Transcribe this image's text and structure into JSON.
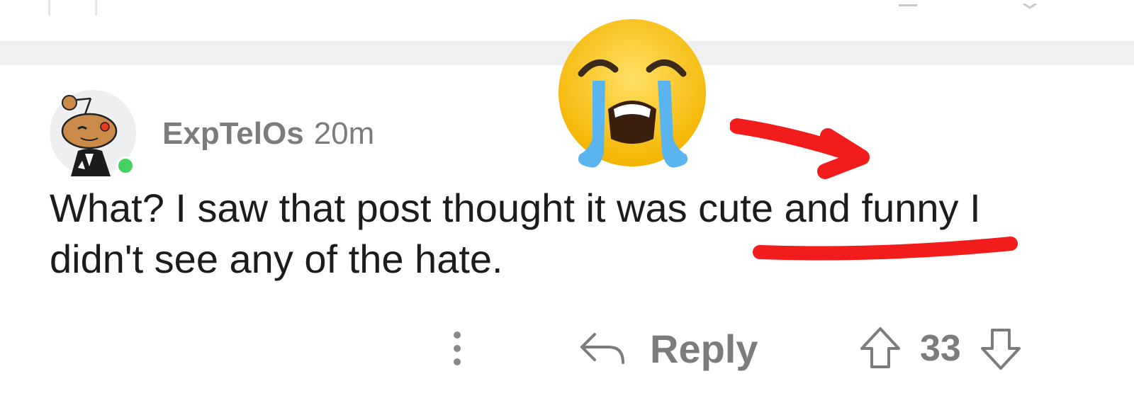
{
  "comment": {
    "username": "ExpTelOs",
    "timestamp": "20m",
    "text_line1": "What? I saw that post thought it was cute and funny I",
    "text_line2": "didn't see any of the hate.",
    "online": true
  },
  "actions": {
    "more_icon": "more-vertical-icon",
    "reply_icon": "reply-arrow-icon",
    "reply_label": "Reply",
    "upvote_icon": "upvote-arrow-icon",
    "score": "33",
    "downvote_icon": "downvote-arrow-icon"
  },
  "annotations": {
    "emoji": "loudly-crying-face",
    "arrow_color": "#f21c1c",
    "underline_color": "#f21c1c"
  },
  "colors": {
    "meta_text": "#7c7c7c",
    "body_text": "#1c1c1c",
    "separator": "#eef0f2",
    "online_dot": "#46d160"
  }
}
